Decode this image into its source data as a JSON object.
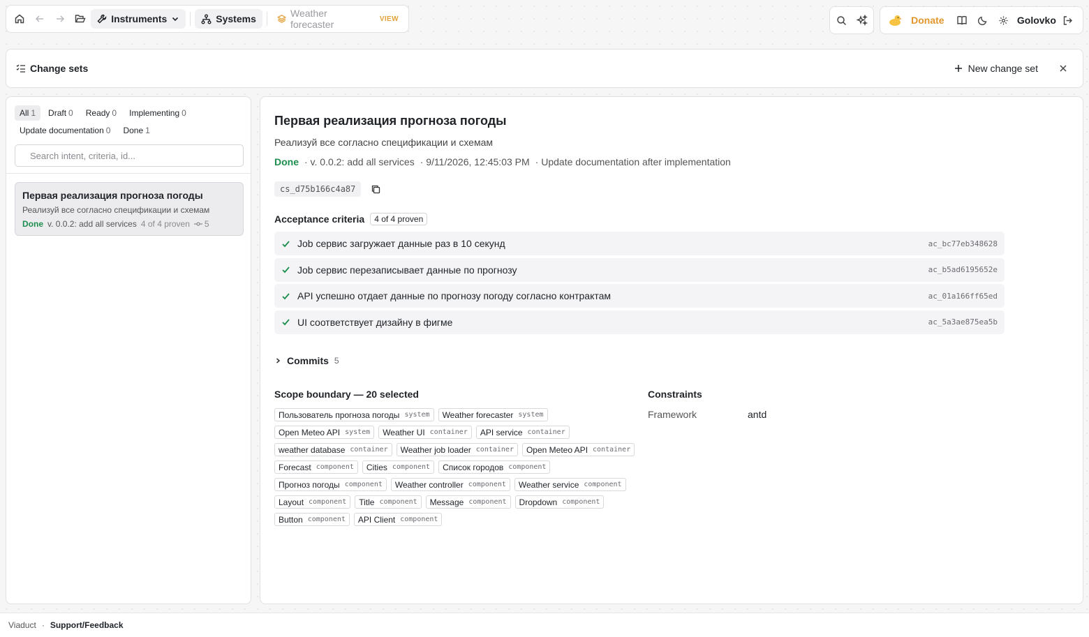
{
  "nav": {
    "instruments_label": "Instruments",
    "systems_label": "Systems",
    "breadcrumb_label": "Weather forecaster",
    "breadcrumb_mode": "VIEW",
    "donate_label": "Donate",
    "user_name": "Golovko"
  },
  "header": {
    "title": "Change sets",
    "new_button_label": "New change set"
  },
  "sidebar": {
    "filters": [
      {
        "label": "All",
        "count": "1",
        "active": true
      },
      {
        "label": "Draft",
        "count": "0"
      },
      {
        "label": "Ready",
        "count": "0"
      },
      {
        "label": "Implementing",
        "count": "0"
      },
      {
        "label": "Update documentation",
        "count": "0"
      },
      {
        "label": "Done",
        "count": "1"
      }
    ],
    "search_placeholder": "Search intent, criteria, id...",
    "items": [
      {
        "title": "Первая реализация прогноза погоды",
        "intent": "Реализуй все согласно спецификации и схемам",
        "status": "Done",
        "version": "v. 0.0.2: add all services",
        "proven": "4 of 4 proven",
        "commits": "5"
      }
    ]
  },
  "detail": {
    "title": "Первая реализация прогноза погоды",
    "intent": "Реализуй все согласно спецификации и схемам",
    "status": "Done",
    "version": "· v. 0.0.2: add all services",
    "date": "· 9/11/2026, 12:45:03 PM",
    "next_step": "· Update documentation after implementation",
    "id": "cs_d75b166c4a87",
    "acceptance_title": "Acceptance criteria",
    "acceptance_badge": "4 of 4 proven",
    "criteria": [
      {
        "text": "Job сервис загружает данные раз в 10 секунд",
        "id": "ac_bc77eb348628"
      },
      {
        "text": "Job сервис перезаписывает данные по прогнозу",
        "id": "ac_b5ad6195652e"
      },
      {
        "text": "API успешно отдает данные по прогнозу погоду согласно контрактам",
        "id": "ac_01a166ff65ed"
      },
      {
        "text": "UI соответствует дизайну в фигме",
        "id": "ac_5a3ae875ea5b"
      }
    ],
    "commits_label": "Commits",
    "commits_count": "5",
    "scope_title": "Scope boundary — 20 selected",
    "scope": [
      {
        "name": "Пользователь прогноза погоды",
        "kind": "system"
      },
      {
        "name": "Weather forecaster",
        "kind": "system"
      },
      {
        "name": "Open Meteo API",
        "kind": "system"
      },
      {
        "name": "Weather UI",
        "kind": "container"
      },
      {
        "name": "API service",
        "kind": "container"
      },
      {
        "name": "weather database",
        "kind": "container"
      },
      {
        "name": "Weather job loader",
        "kind": "container"
      },
      {
        "name": "Open Meteo API",
        "kind": "container"
      },
      {
        "name": "Forecast",
        "kind": "component"
      },
      {
        "name": "Cities",
        "kind": "component"
      },
      {
        "name": "Список городов",
        "kind": "component"
      },
      {
        "name": "Прогноз погоды",
        "kind": "component"
      },
      {
        "name": "Weather controller",
        "kind": "component"
      },
      {
        "name": "Weather service",
        "kind": "component"
      },
      {
        "name": "Layout",
        "kind": "component"
      },
      {
        "name": "Title",
        "kind": "component"
      },
      {
        "name": "Message",
        "kind": "component"
      },
      {
        "name": "Dropdown",
        "kind": "component"
      },
      {
        "name": "Button",
        "kind": "component"
      },
      {
        "name": "API Client",
        "kind": "component"
      }
    ],
    "constraints_title": "Constraints",
    "constraints": [
      {
        "key": "Framework",
        "value": "antd"
      }
    ]
  },
  "footer": {
    "app_name": "Viaduct",
    "separator": "·",
    "support_label": "Support/Feedback"
  },
  "colors": {
    "done": "#1e8e4e",
    "donate": "#e2962b",
    "view_badge": "#e2a23b"
  }
}
